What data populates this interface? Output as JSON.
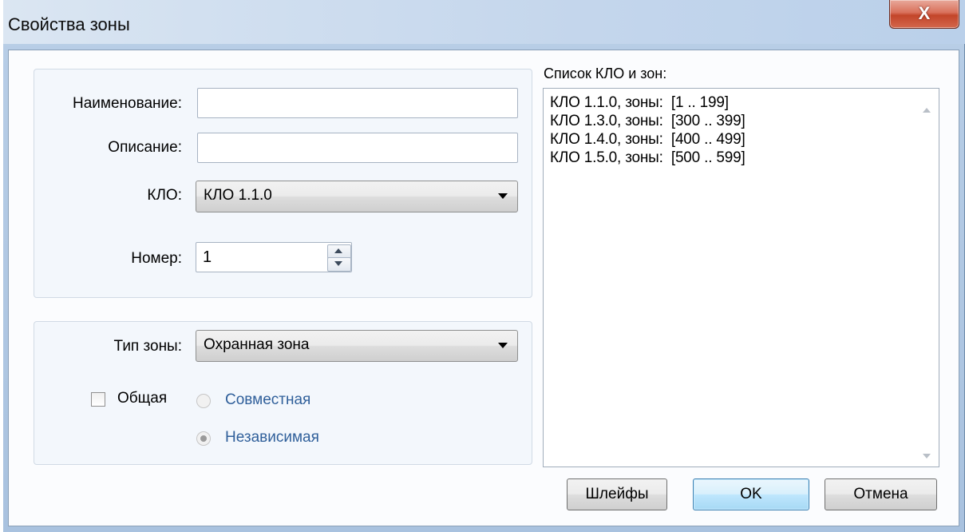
{
  "window": {
    "title": "Свойства зоны",
    "close_label": "X"
  },
  "form": {
    "name_label": "Наименование:",
    "name_value": "",
    "description_label": "Описание:",
    "description_value": "",
    "klo_label": "КЛО:",
    "klo_selected": "КЛО 1.1.0",
    "number_label": "Номер:",
    "number_value": "1",
    "zone_type_label": "Тип зоны:",
    "zone_type_selected": "Охранная зона",
    "shared_label": "Общая",
    "shared_checked": false,
    "radio_joint_label": "Совместная",
    "radio_independent_label": "Независимая",
    "radio_independent_selected": true
  },
  "list": {
    "header": "Список КЛО и зон:",
    "items": [
      "КЛО 1.1.0, зоны:  [1 .. 199]",
      "КЛО 1.3.0, зоны:  [300 .. 399]",
      "КЛО 1.4.0, зоны:  [400 .. 499]",
      "КЛО 1.5.0, зоны:  [500 .. 599]"
    ]
  },
  "buttons": {
    "loops": "Шлейфы",
    "ok": "OK",
    "cancel": "Отмена"
  },
  "colors": {
    "accent_blue": "#2f5f9a",
    "close_red": "#c3452a"
  }
}
